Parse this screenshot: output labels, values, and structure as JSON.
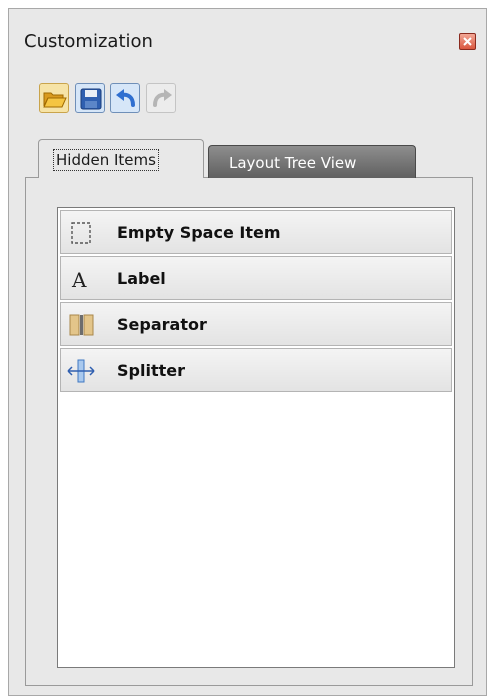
{
  "window": {
    "title": "Customization"
  },
  "icons": {
    "close": "close-icon",
    "open": "folder-open-icon",
    "save": "save-icon",
    "undo": "undo-icon",
    "redo": "redo-icon"
  },
  "toolbar": {
    "buttons": [
      {
        "name": "open",
        "enabled": true
      },
      {
        "name": "save",
        "enabled": true
      },
      {
        "name": "undo",
        "enabled": true
      },
      {
        "name": "redo",
        "enabled": false
      }
    ]
  },
  "tabs": [
    {
      "label": "Hidden Items",
      "active": true
    },
    {
      "label": "Layout Tree View",
      "active": false
    }
  ],
  "hidden_items": [
    {
      "label": "Empty Space Item",
      "icon": "empty-space-icon"
    },
    {
      "label": "Label",
      "icon": "label-icon"
    },
    {
      "label": "Separator",
      "icon": "separator-icon"
    },
    {
      "label": "Splitter",
      "icon": "splitter-icon"
    }
  ],
  "colors": {
    "panel_bg": "#e8e8e8",
    "inactive_tab": "#6e6e6e",
    "close_button": "#d9573f",
    "toolbar_blue": "#2f6fd0"
  }
}
